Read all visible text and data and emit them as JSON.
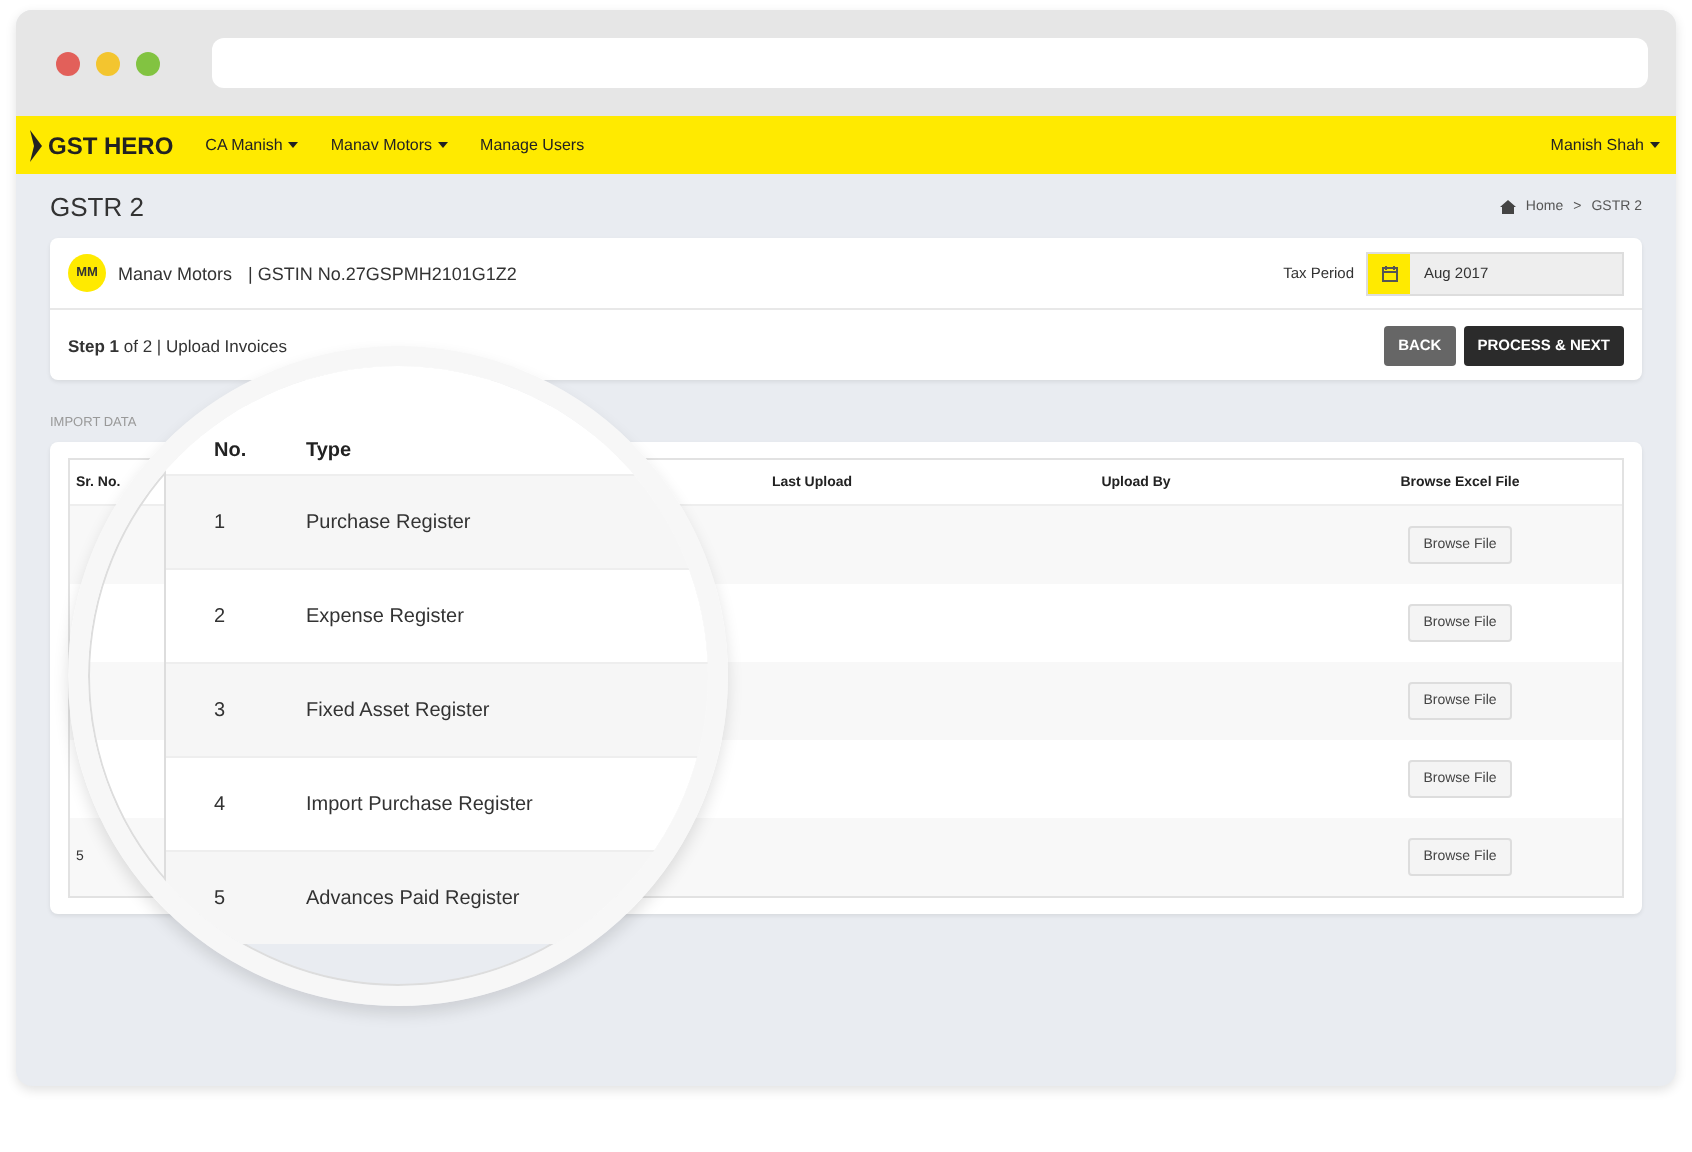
{
  "browser": {
    "dots": [
      {
        "color": "#e2605a"
      },
      {
        "color": "#f3c52f"
      },
      {
        "color": "#82c341"
      }
    ]
  },
  "navbar": {
    "brand": "GST HERO",
    "menu": [
      {
        "label": "CA Manish",
        "dropdown": true
      },
      {
        "label": "Manav Motors",
        "dropdown": true
      },
      {
        "label": "Manage Users",
        "dropdown": false
      }
    ],
    "user": {
      "label": "Manish Shah",
      "dropdown": true
    }
  },
  "page": {
    "title": "GSTR 2",
    "breadcrumb": [
      "Home",
      "GSTR 2"
    ],
    "separator": ">"
  },
  "company": {
    "initials": "MM",
    "name": "Manav Motors",
    "gstin": "| GSTIN No.27GSPMH2101G1Z2",
    "tax_period_label": "Tax Period",
    "tax_period": "Aug 2017"
  },
  "step": {
    "text": "**Step 1** of 2 | Upload Invoices",
    "buttons": [
      {
        "label": "BACK",
        "kind": "secondary"
      },
      {
        "label": "PROCESS & NEXT",
        "kind": "primary"
      }
    ]
  },
  "section_label": "IMPORT DATA",
  "table": {
    "columns": [
      "Sr. No.",
      "Last Upload",
      "Upload By",
      "Browse Excel File"
    ],
    "rows": [
      {
        "button": "Browse File"
      },
      {
        "button": "Browse File"
      },
      {
        "button": "Browse File"
      },
      {
        "button": "Browse File"
      },
      {
        "sr_no": "5",
        "button": "Browse File"
      }
    ]
  },
  "magnifier": {
    "columns": [
      "No.",
      "Type"
    ],
    "rows": [
      {
        "no": "1",
        "type": "Purchase Register"
      },
      {
        "no": "2",
        "type": "Expense Register"
      },
      {
        "no": "3",
        "type": "Fixed Asset Register"
      },
      {
        "no": "4",
        "type": "Import Purchase Register"
      },
      {
        "no": "5",
        "type": "Advances Paid Register"
      }
    ]
  }
}
